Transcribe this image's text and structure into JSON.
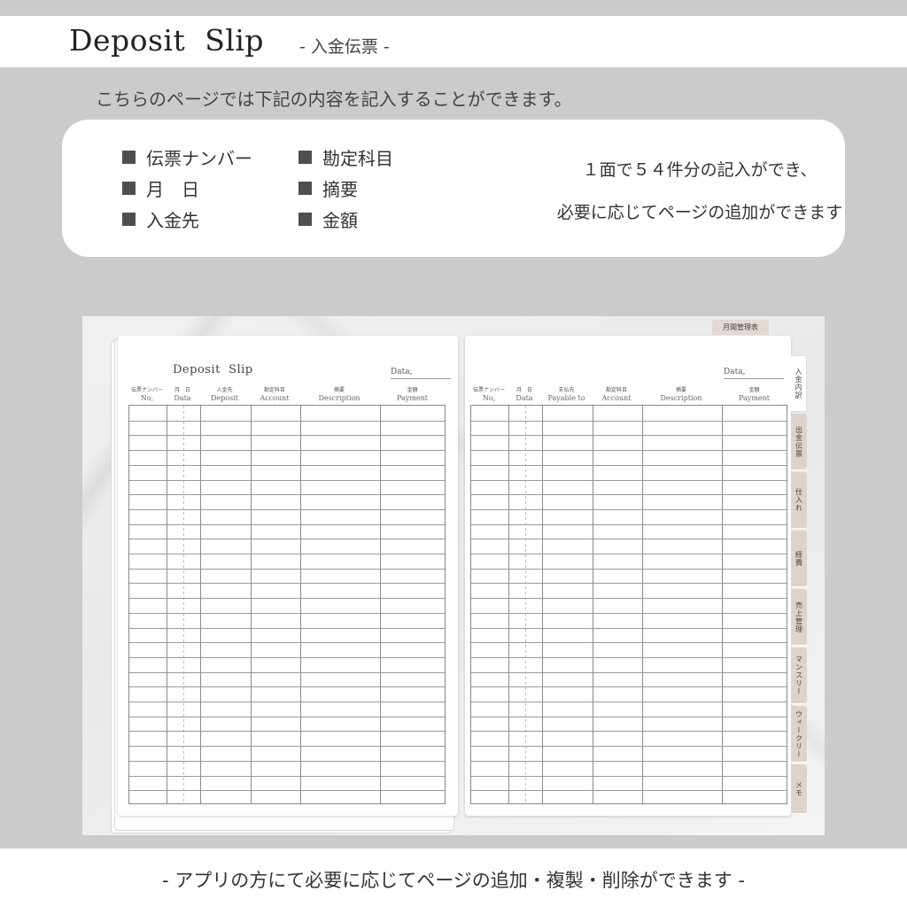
{
  "header": {
    "title": "Deposit  Slip",
    "subtitle": "- 入金伝票 -"
  },
  "intro": "こちらのページでは下記の内容を記入することができます。",
  "features": {
    "left": [
      "伝票ナンバー",
      "月　日",
      "入金先"
    ],
    "right": [
      "勘定科目",
      "摘要",
      "金額"
    ]
  },
  "note": {
    "line1": "１面で５４件分の記入ができ、",
    "line2": "必要に応じてページの追加ができます"
  },
  "notebook": {
    "title": "Deposit  Slip",
    "date_label": "Data,",
    "top_tab": "月間管理表",
    "left_columns": [
      {
        "jp": "伝票ナンバー",
        "en": "No,"
      },
      {
        "jp": "月　日",
        "en": "Data"
      },
      {
        "jp": "入金先",
        "en": "Deposit"
      },
      {
        "jp": "勘定科目",
        "en": "Account"
      },
      {
        "jp": "摘要",
        "en": "Description"
      },
      {
        "jp": "金額",
        "en": "Payment"
      }
    ],
    "right_columns": [
      {
        "jp": "伝票ナンバー",
        "en": "No,"
      },
      {
        "jp": "月　日",
        "en": "Data"
      },
      {
        "jp": "支払先",
        "en": "Payable  to"
      },
      {
        "jp": "勘定科目",
        "en": "Account"
      },
      {
        "jp": "摘要",
        "en": "Description"
      },
      {
        "jp": "金額",
        "en": "Payment"
      }
    ],
    "rows_per_page": 27,
    "side_tabs": [
      "入金内訳",
      "出金伝票",
      "仕入れ",
      "経費",
      "売上管理",
      "マンスリー",
      "ウィークリー",
      "メモ"
    ],
    "active_tab": 0
  },
  "footer": "- アプリの方にて必要に応じてページの追加・複製・削除ができます -"
}
